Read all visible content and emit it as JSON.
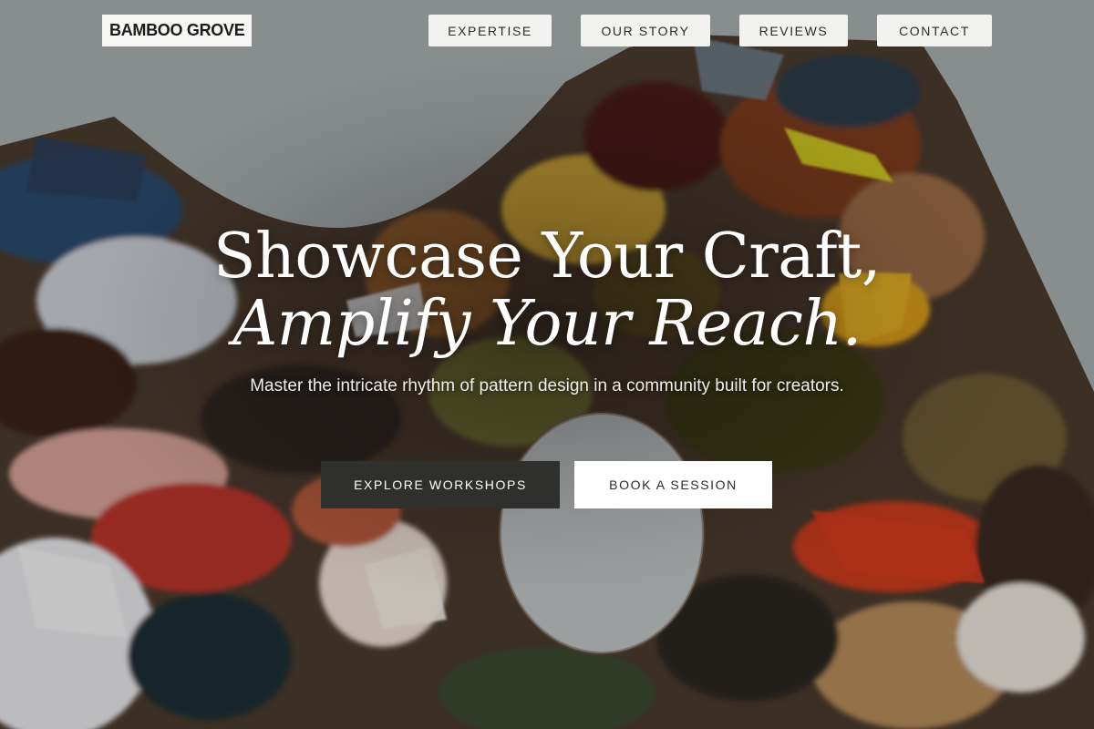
{
  "header": {
    "brand": "BAMBOO GROVE",
    "nav": {
      "expertise": "EXPERTISE",
      "story": "OUR STORY",
      "reviews": "REVIEWS",
      "contact": "CONTACT"
    }
  },
  "hero": {
    "headline_line1": "Showcase Your Craft,",
    "headline_line2": "Amplify Your Reach.",
    "subtitle": "Master the intricate rhythm of pattern design in a community built for creators.",
    "primary_cta": "EXPLORE WORKSHOPS",
    "secondary_cta": "BOOK A SESSION",
    "background_image": "paint-palette-photo"
  },
  "colors": {
    "wall": "#a9aeb0",
    "primary_button": "#2f2f2d",
    "secondary_button": "#ffffff",
    "nav_button": "#f2f2f0"
  }
}
